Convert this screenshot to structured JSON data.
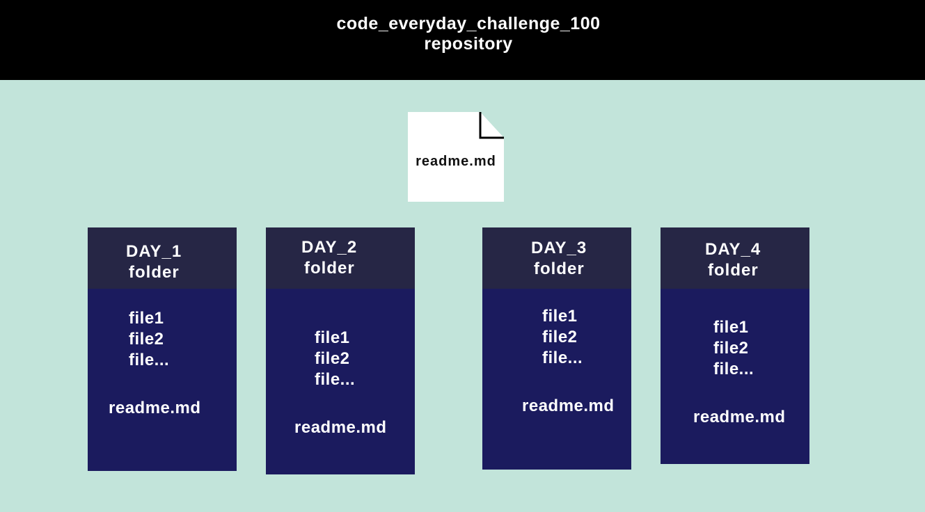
{
  "header": {
    "title": "code_everyday_challenge_100",
    "subtitle": "repository"
  },
  "root_file": {
    "label": "readme.md",
    "icon": "document-icon"
  },
  "folders": [
    {
      "name": "DAY_1",
      "kind": "folder",
      "files": [
        "file1",
        "file2",
        "file..."
      ],
      "readme": "readme.md"
    },
    {
      "name": "DAY_2",
      "kind": "folder",
      "files": [
        "file1",
        "file2",
        "file..."
      ],
      "readme": "readme.md"
    },
    {
      "name": "DAY_3",
      "kind": "folder",
      "files": [
        "file1",
        "file2",
        "file..."
      ],
      "readme": "readme.md"
    },
    {
      "name": "DAY_4",
      "kind": "folder",
      "files": [
        "file1",
        "file2",
        "file..."
      ],
      "readme": "readme.md"
    }
  ],
  "colors": {
    "background": "#c2e4da",
    "header": "#000000",
    "folder_body": "#1b1b5e",
    "folder_head": "#262645",
    "document": "#ffffff"
  }
}
